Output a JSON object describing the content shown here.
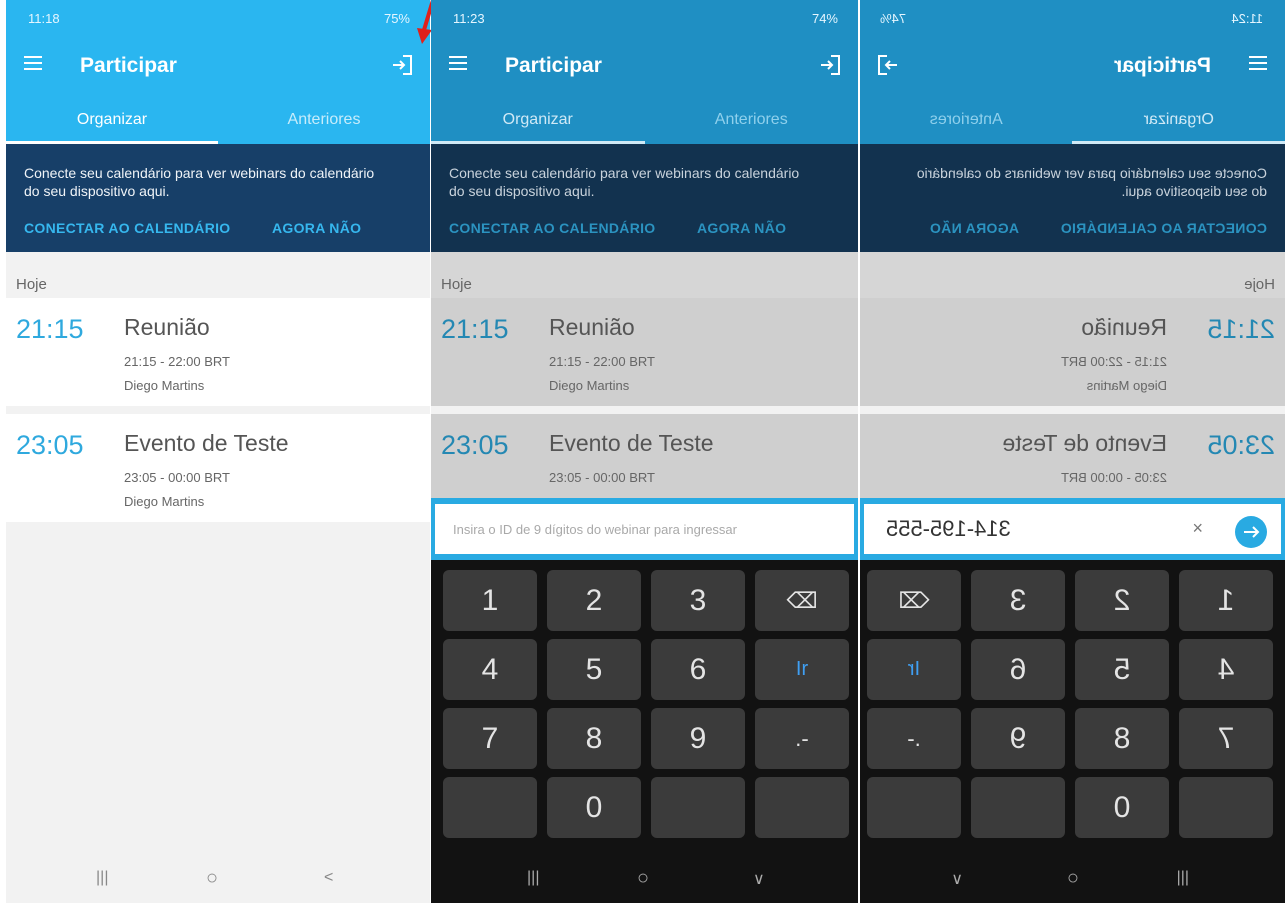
{
  "colors": {
    "app_bar": "#29aae2",
    "banner": "#173f68",
    "accent": "#36b7ee",
    "annotation": "#e0201b"
  },
  "screens": [
    {
      "status": {
        "time": "11:18",
        "indicators": "75%"
      },
      "app_bar": {
        "title": "Participar"
      },
      "tabs": [
        "Organizar",
        "Anteriores"
      ],
      "banner": {
        "message": "Conecte seu calendário para ver webinars do calendário do seu dispositivo aqui.",
        "connect": "CONECTAR AO CALENDÁRIO",
        "dismiss": "AGORA NÃO"
      },
      "section": "Hoje",
      "events": [
        {
          "time": "21:15",
          "name": "Reunião",
          "range": "21:15 - 22:00 BRT",
          "organizer": "Diego Martins"
        },
        {
          "time": "23:05",
          "name": "Evento de Teste",
          "range": "23:05 - 00:00 BRT",
          "organizer": "Diego Martins"
        }
      ],
      "nav": [
        "|||",
        "○",
        "<"
      ]
    },
    {
      "status": {
        "time": "11:23",
        "indicators": "74%"
      },
      "app_bar": {
        "title": "Participar"
      },
      "tabs": [
        "Organizar",
        "Anteriores"
      ],
      "banner": {
        "message": "Conecte seu calendário para ver webinars do calendário do seu dispositivo aqui.",
        "connect": "CONECTAR AO CALENDÁRIO",
        "dismiss": "AGORA NÃO"
      },
      "section": "Hoje",
      "events": [
        {
          "time": "21:15",
          "name": "Reunião",
          "range": "21:15 - 22:00 BRT",
          "organizer": "Diego Martins"
        },
        {
          "time": "23:05",
          "name": "Evento de Teste",
          "range": "23:05 - 00:00 BRT",
          "organizer": ""
        }
      ],
      "id_input": {
        "placeholder": "Insira o ID de 9 dígitos do webinar para ingressar",
        "value": ""
      },
      "keypad": [
        "1",
        "2",
        "3",
        "⌫",
        "4",
        "5",
        "6",
        "Ir",
        "7",
        "8",
        "9",
        ".-",
        "",
        "0",
        "",
        ""
      ],
      "nav": [
        "|||",
        "○",
        "∨"
      ]
    },
    {
      "status": {
        "time": "11:24",
        "indicators": "74%"
      },
      "app_bar": {
        "title": "Participar"
      },
      "tabs": [
        "Organizar",
        "Anteriores"
      ],
      "banner": {
        "message": "Conecte seu calendário para ver webinars do calendário do seu dispositivo aqui.",
        "connect": "CONECTAR AO CALENDÁRIO",
        "dismiss": "AGORA NÃO"
      },
      "section": "Hoje",
      "events": [
        {
          "time": "21:15",
          "name": "Reunião",
          "range": "21:15 - 22:00 BRT",
          "organizer": "Diego Martins"
        },
        {
          "time": "23:05",
          "name": "Evento de Teste",
          "range": "23:05 - 00:00 BRT",
          "organizer": ""
        }
      ],
      "id_input": {
        "placeholder": "",
        "value": "314-195-555"
      },
      "keypad": [
        "1",
        "2",
        "3",
        "⌫",
        "4",
        "5",
        "6",
        "Ir",
        "7",
        "8",
        "9",
        ".-",
        "",
        "0",
        "",
        ""
      ],
      "nav": [
        "|||",
        "○",
        "∨"
      ]
    }
  ]
}
